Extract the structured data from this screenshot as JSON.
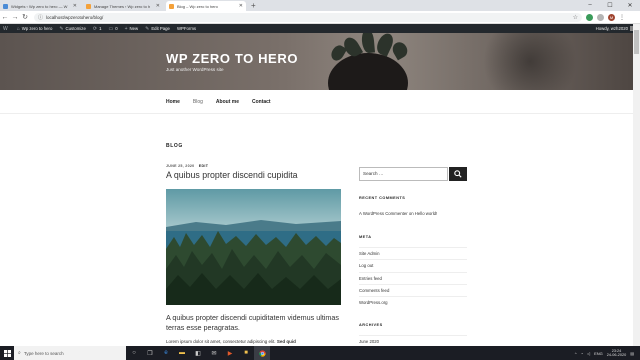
{
  "browser": {
    "tabs": [
      {
        "title": "Widgets ‹ Wp zero to hero — W",
        "active": false
      },
      {
        "title": "Manage Themes ‹ Wp zero to h",
        "active": false
      },
      {
        "title": "Blog – Wp zero to hero",
        "active": true
      }
    ],
    "new_tab": "+",
    "url": "localhost/wpzerotohero/blog/"
  },
  "adminbar": {
    "wp_logo": "W",
    "site": "Wp zero to hero",
    "customize": "Customize",
    "updates": "1",
    "comments": "0",
    "new": "New",
    "edit_page": "Edit Page",
    "wpforms": "WPForms",
    "howdy": "Howdy, wzh2020"
  },
  "header": {
    "title": "WP ZERO TO HERO",
    "tagline": "Just another WordPress site"
  },
  "nav": [
    "Home",
    "Blog",
    "About me",
    "Contact"
  ],
  "main": {
    "section_label": "BLOG",
    "post": {
      "date": "JUNE 25, 2020",
      "edit": "EDIT",
      "title": "A quibus propter discendi cupidita",
      "excerpt": "A quibus propter discendi cupiditatem videmus ultimas terras esse peragratas.",
      "lorem": "Lorem ipsum dolor sit amet, consectetur adipiscing elit.",
      "lorem_bold": "Sed quid"
    }
  },
  "sidebar": {
    "search_placeholder": "Search …",
    "recent_comments_title": "RECENT COMMENTS",
    "recent_comment": "A WordPress Commenter on Hello world!",
    "meta_title": "META",
    "meta_links": [
      "Site Admin",
      "Log out",
      "Entries feed",
      "Comments feed",
      "WordPress.org"
    ],
    "archives_title": "ARCHIVES",
    "archive_item": "June 2020"
  },
  "taskbar": {
    "search": "Type here to search",
    "lang": "ENG",
    "time": "23:24",
    "date": "24-06-2020"
  },
  "colors": {
    "adminbar": "#23282d",
    "taskbar": "#1b1d24",
    "tab_favicon": "#f4a13a"
  }
}
